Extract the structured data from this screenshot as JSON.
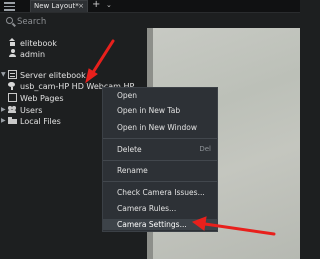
{
  "tabbar": {
    "active_tab": "New Layout*",
    "close_symbol": "×",
    "add_symbol": "+",
    "more_symbol": "⌄"
  },
  "search": {
    "placeholder": "Search"
  },
  "tree": {
    "user_section": [
      {
        "label": "elitebook",
        "icon": "home-icon"
      },
      {
        "label": "admin",
        "icon": "user-icon"
      }
    ],
    "server": {
      "label": "Server elitebook",
      "icon": "server-icon"
    },
    "camera": {
      "label": "usb_cam-HP HD Webcam HP",
      "icon": "camera-icon"
    },
    "others": [
      {
        "label": "Web Pages",
        "icon": "globe-icon"
      },
      {
        "label": "Users",
        "icon": "users-icon"
      },
      {
        "label": "Local Files",
        "icon": "folder-icon"
      }
    ]
  },
  "context_menu": {
    "items": [
      {
        "label": "Open"
      },
      {
        "label": "Open in New Tab"
      },
      {
        "label": "Open in New Window"
      },
      {
        "label": "Delete",
        "shortcut": "Del"
      },
      {
        "label": "Rename"
      },
      {
        "label": "Check Camera Issues..."
      },
      {
        "label": "Camera Rules..."
      },
      {
        "label": "Camera Settings...",
        "hovered": true
      }
    ]
  },
  "annotations": {
    "arrow_color": "#e8201c"
  },
  "colors": {
    "background": "#1d1f20",
    "menu_background": "#2d3136",
    "camera_feed": "#c2c4bd"
  }
}
